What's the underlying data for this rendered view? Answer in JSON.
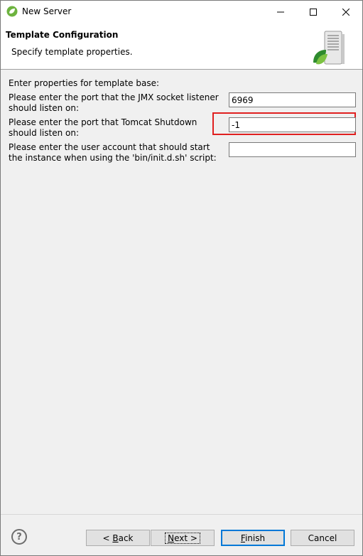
{
  "window": {
    "title": "New Server",
    "icon": "spring-leaf-icon",
    "controls": {
      "minimize": "minimize-icon",
      "maximize": "maximize-icon",
      "close": "close-icon"
    }
  },
  "banner": {
    "title": "Template Configuration",
    "description": "Specify template properties.",
    "image": "server-tower-icon"
  },
  "content": {
    "intro": "Enter properties for template base:",
    "fields": [
      {
        "label": "Please enter the port that the JMX socket listener should listen on:",
        "value": "6969"
      },
      {
        "label": "Please enter the port that Tomcat Shutdown should listen on:",
        "value": "-1"
      },
      {
        "label": "Please enter the user account that should start the instance when using the 'bin/init.d.sh' script:",
        "value": ""
      }
    ]
  },
  "footer": {
    "help_icon": "help-icon",
    "help_glyph": "?",
    "back": {
      "prefix": "< ",
      "mnemonic": "B",
      "rest": "ack"
    },
    "next": {
      "mnemonic": "N",
      "rest": "ext >"
    },
    "finish": {
      "mnemonic": "F",
      "rest": "inish"
    },
    "cancel": "Cancel"
  },
  "colors": {
    "highlight": "#e02020",
    "default_button_border": "#0078d7",
    "dialog_background": "#f0f0f0"
  }
}
